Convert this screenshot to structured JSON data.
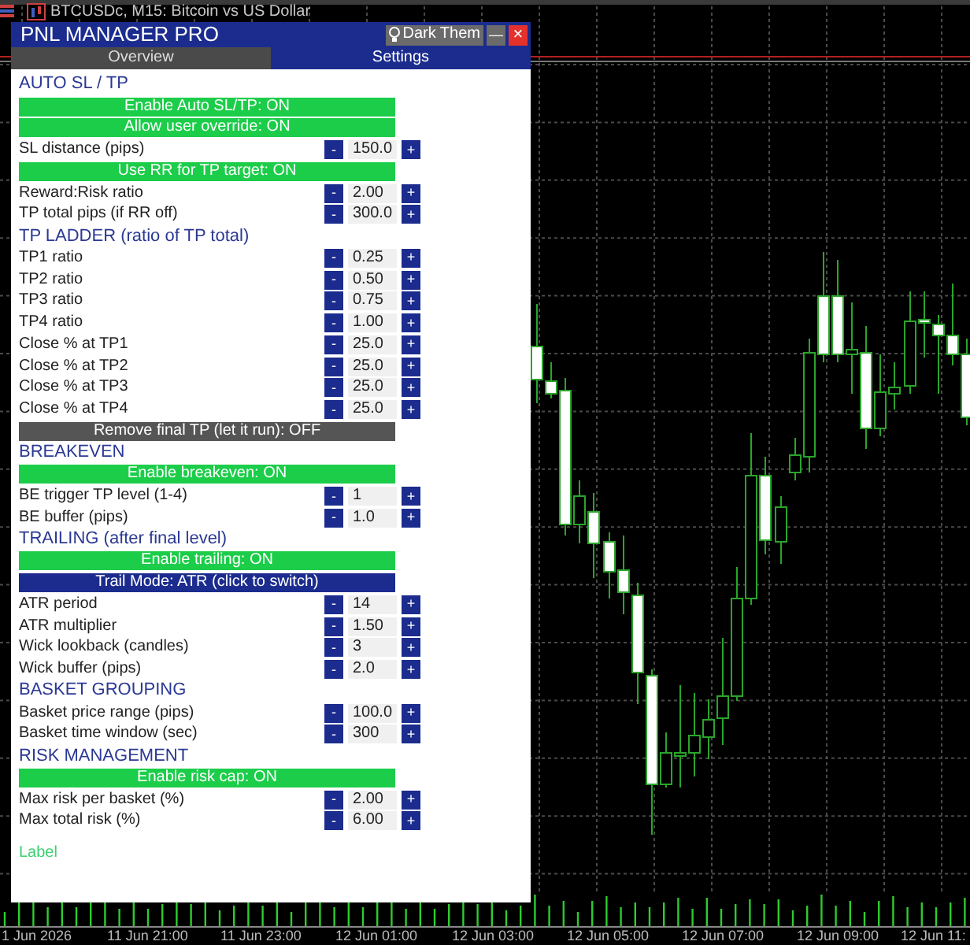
{
  "chart": {
    "symbol_title": "BTCUSDc, M15:  Bitcoin vs US Dollar",
    "time_labels": [
      "1 Jun 2026",
      "11 Jun 21:00",
      "11 Jun 23:00",
      "12 Jun 01:00",
      "12 Jun 03:00",
      "12 Jun 05:00",
      "12 Jun 07:00",
      "12 Jun 09:00",
      "12 Jun 11:"
    ]
  },
  "panel": {
    "title": "PNL MANAGER PRO",
    "theme_button": "Dark Them",
    "minimize": "—",
    "close": "×",
    "tabs": [
      {
        "label": "Overview",
        "selected": false
      },
      {
        "label": "Settings",
        "selected": true
      }
    ],
    "rows": [
      {
        "kind": "heading",
        "text": "AUTO SL / TP"
      },
      {
        "kind": "toggle",
        "text": "Enable Auto SL/TP: ON",
        "on": true
      },
      {
        "kind": "toggle",
        "text": "Allow user override: ON",
        "on": true
      },
      {
        "kind": "number",
        "label": "SL distance (pips)",
        "minus": "-",
        "value": "150.0",
        "plus": "+"
      },
      {
        "kind": "toggle",
        "text": "Use RR for TP target: ON",
        "on": true
      },
      {
        "kind": "number",
        "label": "Reward:Risk ratio",
        "minus": "-",
        "value": "2.00",
        "plus": "+"
      },
      {
        "kind": "number",
        "label": "TP total pips (if RR off)",
        "minus": "-",
        "value": "300.0",
        "plus": "+"
      },
      {
        "kind": "heading",
        "text": "TP LADDER (ratio of TP total)"
      },
      {
        "kind": "number",
        "label": "TP1 ratio",
        "minus": "-",
        "value": "0.25",
        "plus": "+"
      },
      {
        "kind": "number",
        "label": "TP2 ratio",
        "minus": "-",
        "value": "0.50",
        "plus": "+"
      },
      {
        "kind": "number",
        "label": "TP3 ratio",
        "minus": "-",
        "value": "0.75",
        "plus": "+"
      },
      {
        "kind": "number",
        "label": "TP4 ratio",
        "minus": "-",
        "value": "1.00",
        "plus": "+"
      },
      {
        "kind": "number",
        "label": "Close % at TP1",
        "minus": "-",
        "value": "25.0",
        "plus": "+"
      },
      {
        "kind": "number",
        "label": "Close % at TP2",
        "minus": "-",
        "value": "25.0",
        "plus": "+"
      },
      {
        "kind": "number",
        "label": "Close % at TP3",
        "minus": "-",
        "value": "25.0",
        "plus": "+"
      },
      {
        "kind": "number",
        "label": "Close % at TP4",
        "minus": "-",
        "value": "25.0",
        "plus": "+"
      },
      {
        "kind": "toggle",
        "text": "Remove final TP (let it run): OFF",
        "on": false
      },
      {
        "kind": "heading",
        "text": "BREAKEVEN"
      },
      {
        "kind": "toggle",
        "text": "Enable breakeven: ON",
        "on": true
      },
      {
        "kind": "number",
        "label": "BE trigger TP level (1-4)",
        "minus": "-",
        "value": "1",
        "plus": "+"
      },
      {
        "kind": "number",
        "label": "BE buffer (pips)",
        "minus": "-",
        "value": "1.0",
        "plus": "+"
      },
      {
        "kind": "heading",
        "text": "TRAILING (after final level)"
      },
      {
        "kind": "toggle",
        "text": "Enable trailing: ON",
        "on": true
      },
      {
        "kind": "mode",
        "text": "Trail Mode: ATR (click to switch)"
      },
      {
        "kind": "number",
        "label": "ATR period",
        "minus": "-",
        "value": "14",
        "plus": "+"
      },
      {
        "kind": "number",
        "label": "ATR multiplier",
        "minus": "-",
        "value": "1.50",
        "plus": "+"
      },
      {
        "kind": "number",
        "label": "Wick lookback (candles)",
        "minus": "-",
        "value": "3",
        "plus": "+"
      },
      {
        "kind": "number",
        "label": "Wick buffer (pips)",
        "minus": "-",
        "value": "2.0",
        "plus": "+"
      },
      {
        "kind": "heading",
        "text": "BASKET GROUPING"
      },
      {
        "kind": "number",
        "label": "Basket price range (pips)",
        "minus": "-",
        "value": "100.0",
        "plus": "+"
      },
      {
        "kind": "number",
        "label": "Basket time window (sec)",
        "minus": "-",
        "value": "300",
        "plus": "+"
      },
      {
        "kind": "heading",
        "text": "RISK MANAGEMENT"
      },
      {
        "kind": "toggle",
        "text": "Enable risk cap: ON",
        "on": true
      },
      {
        "kind": "number",
        "label": "Max risk per basket (%)",
        "minus": "-",
        "value": "2.00",
        "plus": "+"
      },
      {
        "kind": "number",
        "label": "Max total risk (%)",
        "minus": "-",
        "value": "6.00",
        "plus": "+"
      }
    ],
    "footer_label": "Label"
  }
}
